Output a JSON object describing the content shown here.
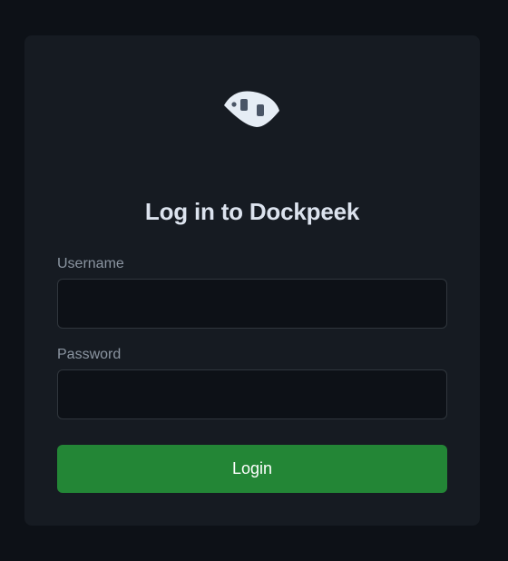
{
  "app": {
    "title": "Log in to Dockpeek",
    "logo_icon": "dockpeek-logo-icon"
  },
  "form": {
    "username_label": "Username",
    "username_value": "",
    "username_placeholder": "",
    "password_label": "Password",
    "password_value": "",
    "password_placeholder": "",
    "login_label": "Login"
  },
  "colors": {
    "page_background": "#0d1117",
    "card_background": "#161b22",
    "input_background": "#0d1117",
    "input_border": "#30363d",
    "title_text": "#dce3ee",
    "label_text": "#8b95a1",
    "button_background": "#238636",
    "button_text": "#ffffff",
    "logo_fill": "#e6edf5",
    "logo_detail": "#4a5566"
  }
}
